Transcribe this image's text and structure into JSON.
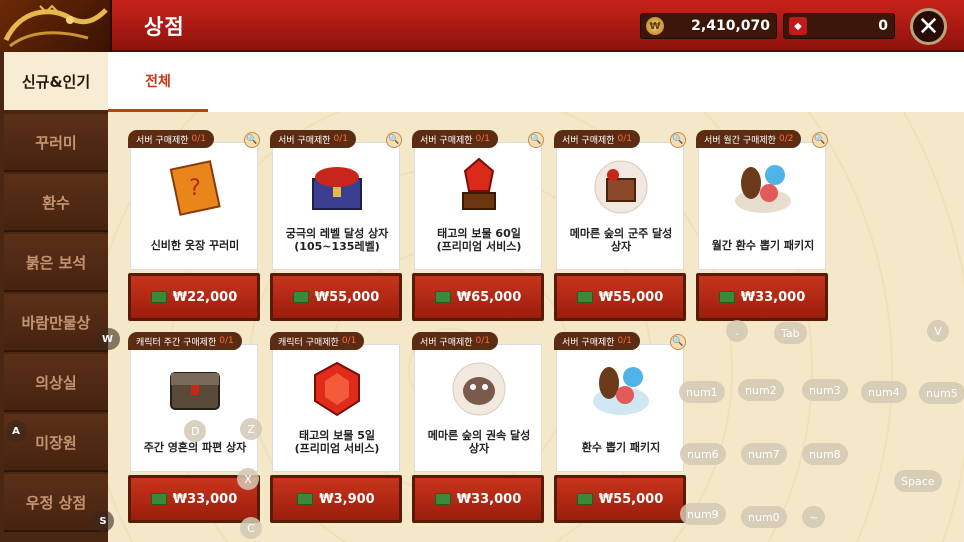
{
  "header": {
    "title": "상점"
  },
  "currency": {
    "meso": "2,410,070",
    "point": "0"
  },
  "close_label": "✕",
  "sidebar": {
    "items": [
      {
        "label": "신규&인기"
      },
      {
        "label": "꾸러미"
      },
      {
        "label": "환수"
      },
      {
        "label": "붉은 보석"
      },
      {
        "label": "바람만물상"
      },
      {
        "label": "의상실"
      },
      {
        "label": "미장원"
      },
      {
        "label": "우정 상점"
      }
    ]
  },
  "tabs": [
    {
      "label": "전체"
    }
  ],
  "cards": [
    {
      "limit": "서버 구매제한",
      "count": "0/1",
      "name": "신비한 옷장 꾸러미",
      "price": "₩22,000"
    },
    {
      "limit": "서버 구매제한",
      "count": "0/1",
      "name": "궁극의 레벨 달성 상자\n(105~135레벨)",
      "price": "₩55,000"
    },
    {
      "limit": "서버 구매제한",
      "count": "0/1",
      "name": "태고의 보물 60일\n(프리미엄 서비스)",
      "price": "₩65,000"
    },
    {
      "limit": "서버 구매제한",
      "count": "0/1",
      "name": "메마른 숲의 군주 달성\n상자",
      "price": "₩55,000"
    },
    {
      "limit": "서버 월간 구매제한",
      "count": "0/2",
      "name": "월간 환수 뽑기 패키지",
      "price": "₩33,000"
    },
    {
      "limit": "캐릭터 주간 구매제한",
      "count": "0/1",
      "name": "주간 영혼의 파편 상자",
      "price": "₩33,000"
    },
    {
      "limit": "캐릭터 구매제한",
      "count": "0/1",
      "name": "태고의 보물 5일\n(프리미엄 서비스)",
      "price": "₩3,900"
    },
    {
      "limit": "서버 구매제한",
      "count": "0/1",
      "name": "메마른 숲의 권속 달성\n상자",
      "price": "₩33,000"
    },
    {
      "limit": "서버 구매제한",
      "count": "0/1",
      "name": "환수 뽑기 패키지",
      "price": "₩55,000"
    }
  ],
  "keys": [
    "W",
    "A",
    "S",
    "D",
    "Z",
    "X",
    "C",
    ".",
    "Tab",
    "V",
    "num1",
    "num2",
    "num3",
    "num4",
    "num5",
    "num6",
    "num7",
    "num8",
    "Space",
    "num9",
    "num0",
    "~"
  ],
  "colors": {
    "header_red": "#b31c14",
    "sidebar_brown": "#4a2712",
    "accent": "#c43a1a"
  }
}
